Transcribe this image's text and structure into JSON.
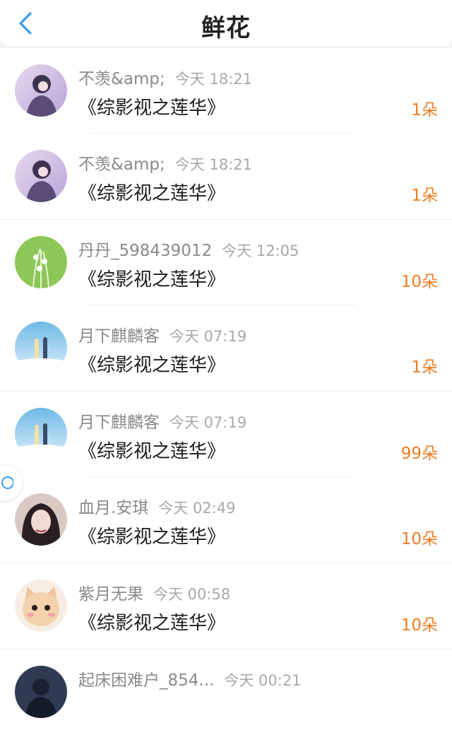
{
  "header": {
    "title": "鲜花",
    "back_icon": "chevron-left-icon",
    "accent": "#3b9cf5"
  },
  "entries": [
    {
      "name": "不羡&amp;",
      "time": "今天 18:21",
      "book": "《综影视之莲华》",
      "count": "1朵"
    },
    {
      "name": "不羡&amp;",
      "time": "今天 18:21",
      "book": "《综影视之莲华》",
      "count": "1朵"
    },
    {
      "name": "丹丹_598439012",
      "time": "今天 12:05",
      "book": "《综影视之莲华》",
      "count": "10朵"
    },
    {
      "name": "月下麒麟客",
      "time": "今天 07:19",
      "book": "《综影视之莲华》",
      "count": "1朵"
    },
    {
      "name": "月下麒麟客",
      "time": "今天 07:19",
      "book": "《综影视之莲华》",
      "count": "99朵"
    },
    {
      "name": "血月.安琪",
      "time": "今天 02:49",
      "book": "《综影视之莲华》",
      "count": "10朵"
    },
    {
      "name": "紫月无果",
      "time": "今天 00:58",
      "book": "《综影视之莲华》",
      "count": "10朵"
    },
    {
      "name": "起床困难户_854...",
      "time": "今天 00:21",
      "book": "",
      "count": ""
    }
  ],
  "colors": {
    "count": "#f07c22",
    "name": "#8a8a8a",
    "time": "#a8a8a8"
  }
}
